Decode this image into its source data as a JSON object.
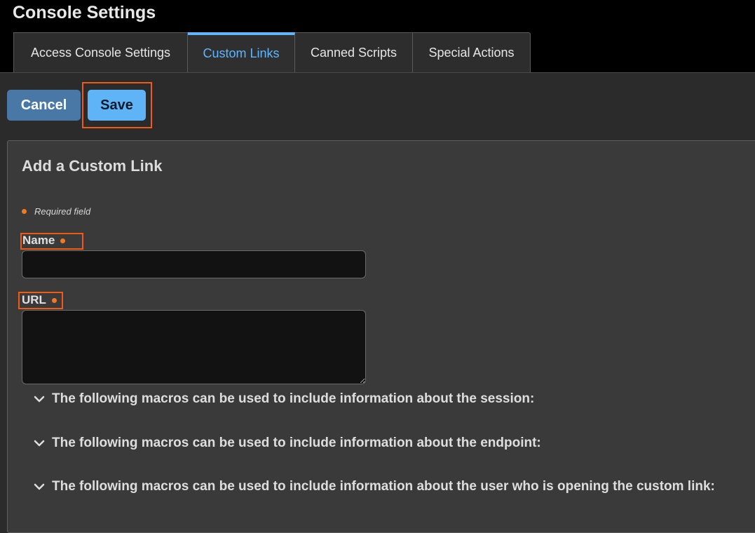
{
  "header": {
    "title": "Console Settings"
  },
  "tabs": [
    {
      "label": "Access Console Settings",
      "active": false
    },
    {
      "label": "Custom Links",
      "active": true
    },
    {
      "label": "Canned Scripts",
      "active": false
    },
    {
      "label": "Special Actions",
      "active": false
    }
  ],
  "toolbar": {
    "cancel_label": "Cancel",
    "save_label": "Save"
  },
  "form": {
    "title": "Add a Custom Link",
    "required_note": "Required field",
    "name_label": "Name",
    "name_value": "",
    "url_label": "URL",
    "url_value": ""
  },
  "macros": [
    {
      "label": "The following macros can be used to include information about the session:"
    },
    {
      "label": "The following macros can be used to include information about the endpoint:"
    },
    {
      "label": "The following macros can be used to include information about the user who is opening the custom link:"
    }
  ],
  "colors": {
    "accent": "#5fb6ff",
    "save_button": "#5eb4f7",
    "cancel_button": "#4a78a6",
    "required_dot": "#f07a22",
    "highlight": "#f05a14",
    "background": "#2b2b2b"
  },
  "icons": {
    "macro_toggle": "chevron-down-icon",
    "required_marker": "required-dot-icon"
  }
}
